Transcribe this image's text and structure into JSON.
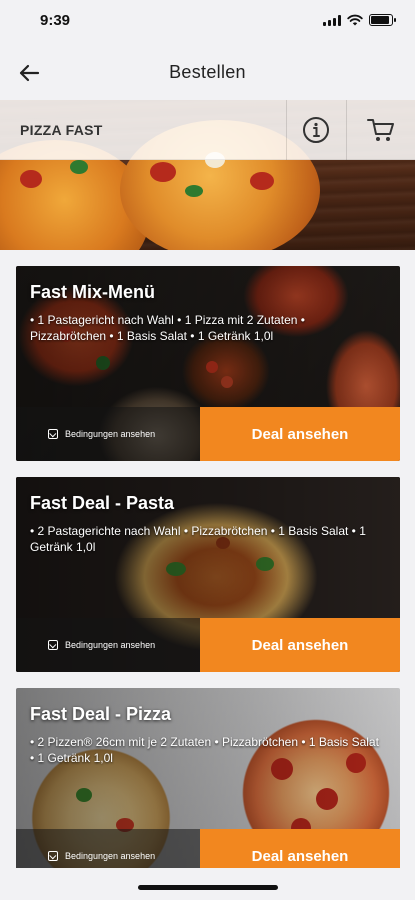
{
  "status_bar": {
    "time": "9:39",
    "icons": [
      "signal-icon",
      "wifi-icon",
      "battery-icon"
    ],
    "battery_level": 0.9
  },
  "nav": {
    "title": "Bestellen",
    "back_icon": "arrow-left-icon"
  },
  "shop": {
    "name": "PIZZA FAST",
    "info_icon": "info-circle-icon",
    "cart_icon": "shopping-cart-icon"
  },
  "deals": [
    {
      "title": "Fast Mix-Menü",
      "description": "• 1 Pastagericht nach Wahl • 1 Pizza mit 2 Zutaten • Pizzabrötchen • 1 Basis Salat • 1 Getränk 1,0l",
      "conditions_label": "Bedingungen ansehen",
      "button_label": "Deal ansehen"
    },
    {
      "title": "Fast Deal - Pasta",
      "description": "• 2 Pastagerichte nach Wahl • Pizzabrötchen • 1 Basis Salat • 1 Getränk 1,0l",
      "conditions_label": "Bedingungen ansehen",
      "button_label": "Deal ansehen"
    },
    {
      "title": "Fast Deal - Pizza",
      "description": "• 2 Pizzen® 26cm mit je 2 Zutaten • Pizzabrötchen • 1 Basis Salat • 1 Getränk 1,0l",
      "conditions_label": "Bedingungen ansehen",
      "button_label": "Deal ansehen"
    }
  ],
  "colors": {
    "accent": "#f2871f",
    "background": "#f2f2f4",
    "text_dark": "#222222"
  }
}
